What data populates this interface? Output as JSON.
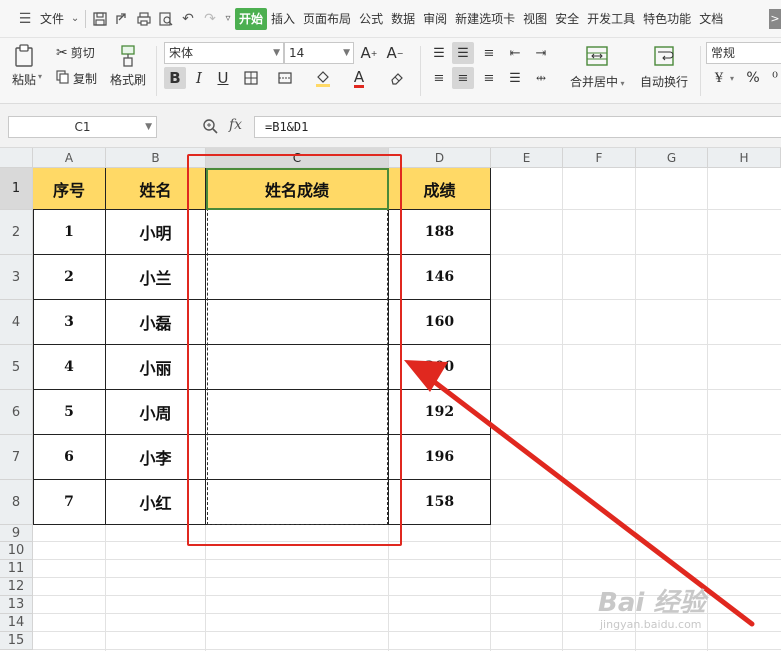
{
  "menubar": {
    "file_label": "文件",
    "tabs": [
      {
        "label": "开始",
        "active": true
      },
      {
        "label": "插入"
      },
      {
        "label": "页面布局"
      },
      {
        "label": "公式"
      },
      {
        "label": "数据"
      },
      {
        "label": "审阅"
      },
      {
        "label": "新建选项卡"
      },
      {
        "label": "视图"
      },
      {
        "label": "安全"
      },
      {
        "label": "开发工具"
      },
      {
        "label": "特色功能"
      },
      {
        "label": "文档"
      }
    ],
    "more_label": ">"
  },
  "ribbon": {
    "paste_label": "粘贴",
    "cut_label": "剪切",
    "copy_label": "复制",
    "format_painter_label": "格式刷",
    "font_name": "宋体",
    "font_size": "14",
    "bold": "B",
    "italic": "I",
    "underline": "U",
    "font_color_letter": "A",
    "merge_label": "合并居中",
    "wrap_label": "自动换行",
    "number_format": "常规",
    "percent": "%"
  },
  "formula_bar": {
    "name_box": "C1",
    "fx": "fx",
    "formula": "=B1&D1"
  },
  "grid": {
    "columns": [
      "A",
      "B",
      "C",
      "D",
      "E",
      "F",
      "G",
      "H"
    ],
    "rows": [
      "1",
      "2",
      "3",
      "4",
      "5",
      "6",
      "7",
      "8",
      "9",
      "10",
      "11",
      "12",
      "13",
      "14",
      "15"
    ],
    "headers": [
      "序号",
      "姓名",
      "姓名成绩",
      "成绩"
    ],
    "records": [
      {
        "no": "1",
        "name": "小明",
        "combined": "",
        "score": "188"
      },
      {
        "no": "2",
        "name": "小兰",
        "combined": "",
        "score": "146"
      },
      {
        "no": "3",
        "name": "小磊",
        "combined": "",
        "score": "160"
      },
      {
        "no": "4",
        "name": "小丽",
        "combined": "",
        "score": "200"
      },
      {
        "no": "5",
        "name": "小周",
        "combined": "",
        "score": "192"
      },
      {
        "no": "6",
        "name": "小李",
        "combined": "",
        "score": "196"
      },
      {
        "no": "7",
        "name": "小红",
        "combined": "",
        "score": "158"
      }
    ]
  },
  "colors": {
    "header_fill": "#ffd966",
    "annotation_red": "#e0281f",
    "active_tab_green": "#4caf50"
  },
  "watermark": {
    "logo": "Bai 经验",
    "url": "jingyan.baidu.com"
  }
}
